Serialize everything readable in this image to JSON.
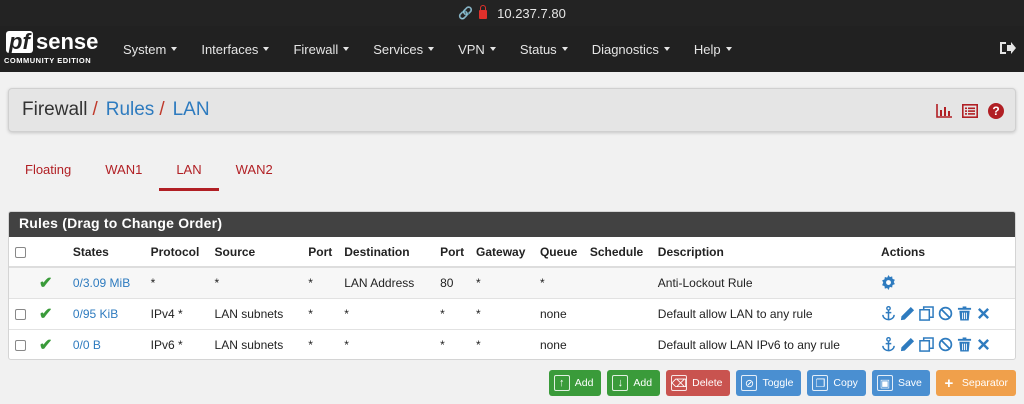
{
  "browser": {
    "address": "10.237.7.80"
  },
  "brand": {
    "logo_pf": "pf",
    "logo_sense": "sense",
    "edition": "COMMUNITY EDITION"
  },
  "nav": [
    {
      "label": "System"
    },
    {
      "label": "Interfaces"
    },
    {
      "label": "Firewall"
    },
    {
      "label": "Services"
    },
    {
      "label": "VPN"
    },
    {
      "label": "Status"
    },
    {
      "label": "Diagnostics"
    },
    {
      "label": "Help"
    }
  ],
  "breadcrumb": {
    "root": "Firewall",
    "sep": "/",
    "level1": "Rules",
    "level2": "LAN"
  },
  "tabs": [
    {
      "label": "Floating"
    },
    {
      "label": "WAN1"
    },
    {
      "label": "LAN"
    },
    {
      "label": "WAN2"
    }
  ],
  "rules": {
    "title": "Rules (Drag to Change Order)",
    "columns": [
      "States",
      "Protocol",
      "Source",
      "Port",
      "Destination",
      "Port",
      "Gateway",
      "Queue",
      "Schedule",
      "Description",
      "Actions"
    ],
    "rows": [
      {
        "states": "0/3.09 MiB",
        "protocol": "*",
        "source": "*",
        "src_port": "*",
        "destination": "LAN Address",
        "dst_port": "80",
        "gateway": "*",
        "queue": "*",
        "schedule": "",
        "description": "Anti-Lockout Rule"
      },
      {
        "states": "0/95 KiB",
        "protocol": "IPv4 *",
        "source": "LAN subnets",
        "src_port": "*",
        "destination": "*",
        "dst_port": "*",
        "gateway": "*",
        "queue": "none",
        "schedule": "",
        "description": "Default allow LAN to any rule"
      },
      {
        "states": "0/0 B",
        "protocol": "IPv6 *",
        "source": "LAN subnets",
        "src_port": "*",
        "destination": "*",
        "dst_port": "*",
        "gateway": "*",
        "queue": "none",
        "schedule": "",
        "description": "Default allow LAN IPv6 to any rule"
      }
    ]
  },
  "buttons": {
    "add_top": "Add",
    "add_bottom": "Add",
    "delete": "Delete",
    "toggle": "Toggle",
    "copy": "Copy",
    "save": "Save",
    "separator": "Separator"
  },
  "colors": {
    "accent": "#b11f24",
    "link": "#2e7bbf",
    "navbar": "#212121",
    "success": "#3a9b3a"
  }
}
